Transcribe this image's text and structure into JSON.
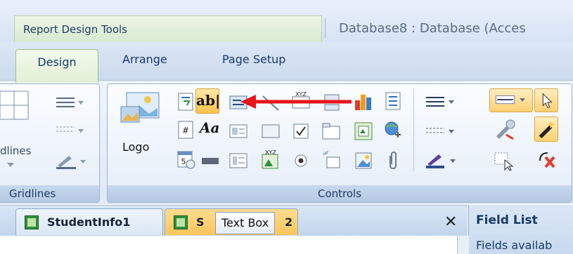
{
  "titlebar": {
    "context_tab": "Report Design Tools",
    "document_title": "Database8 : Database (Acces"
  },
  "ribbon": {
    "tabs": [
      {
        "label": "Design",
        "active": true
      },
      {
        "label": "Arrange",
        "active": false
      },
      {
        "label": "Page Setup",
        "active": false
      }
    ],
    "groups": {
      "gridlines": {
        "label": "Gridlines",
        "partial_button_label": "dlines"
      },
      "controls": {
        "label": "Controls",
        "logo_label": "Logo",
        "text_box_glyph": "ab|",
        "label_glyph": "Aa"
      }
    },
    "icons": [
      "gridlines-icon",
      "line-style-icon",
      "line-width-icon",
      "line-color-icon",
      "title-icon",
      "page-numbers-icon",
      "date-time-icon",
      "text-box-icon",
      "label-icon",
      "button-icon",
      "combo-box-icon",
      "list-box-icon",
      "line-icon",
      "rectangle-icon",
      "page-break-icon",
      "chart-icon",
      "tab-control-icon",
      "check-box-icon",
      "option-group-icon",
      "subform-icon",
      "toggle-button-icon",
      "option-button-icon",
      "image-icon",
      "bound-object-frame-icon",
      "attachment-icon",
      "hyperlink-icon",
      "select-icon",
      "use-control-wizards-icon",
      "insert-activex-icon"
    ]
  },
  "annotation": {
    "color": "#e8151b"
  },
  "tooltip": {
    "text": "Text Box"
  },
  "document_tabs": [
    {
      "label": "StudentInfo1",
      "active": false
    },
    {
      "label": "S",
      "active": true,
      "suffix": "2"
    }
  ],
  "field_list": {
    "title": "Field List",
    "subtitle": "Fields availab"
  },
  "colors": {
    "accent": "#ffc34a",
    "ribbon": "#dfe9f5",
    "context": "#d7ead0"
  }
}
